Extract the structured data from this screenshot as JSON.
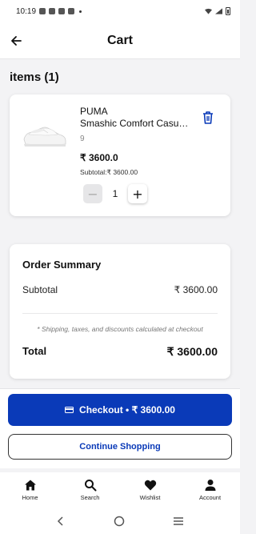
{
  "status_bar": {
    "time": "10:19"
  },
  "app_bar": {
    "title": "Cart"
  },
  "items_section": {
    "heading": "items (1)"
  },
  "cart_item": {
    "brand": "PUMA",
    "name": "Smashic Comfort Casual Sneakers",
    "size": "9",
    "price": "₹ 3600.0",
    "subtotal": "Subtotal:₹ 3600.00",
    "quantity": "1",
    "minus_symbol": "−",
    "plus_symbol": "+"
  },
  "order_summary": {
    "title": "Order Summary",
    "subtotal_label": "Subtotal",
    "subtotal_value": "₹ 3600.00",
    "note": "* Shipping, taxes, and discounts calculated at checkout",
    "total_label": "Total",
    "total_value": "₹ 3600.00"
  },
  "actions": {
    "checkout_label": "Checkout • ₹ 3600.00",
    "continue_label": "Continue Shopping"
  },
  "bottom_nav": {
    "items": [
      {
        "label": "Home",
        "icon": "home-icon"
      },
      {
        "label": "Search",
        "icon": "search-icon"
      },
      {
        "label": "Wishlist",
        "icon": "heart-icon"
      },
      {
        "label": "Account",
        "icon": "person-icon"
      }
    ]
  },
  "colors": {
    "primary": "#0a3ab8",
    "background": "#f3f3f5",
    "card": "#ffffff"
  }
}
